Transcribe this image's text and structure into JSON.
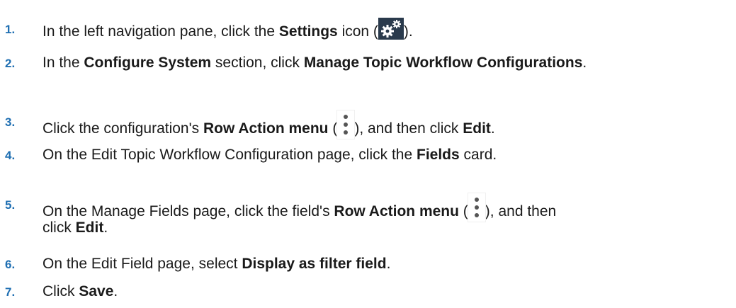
{
  "steps": [
    {
      "number": "1.",
      "text_a": "In the left navigation pane, click the ",
      "bold_a": "Settings",
      "text_b": " icon (",
      "icon": "gear-icon",
      "text_c": ")."
    },
    {
      "number": "2.",
      "text_a": "In the ",
      "bold_a": "Configure System",
      "text_b": " section, click ",
      "bold_b": "Manage Topic Workflow Configurations",
      "text_c": "."
    },
    {
      "number": "3.",
      "text_a": "Click the configuration's ",
      "bold_a": "Row Action menu",
      "text_b": " (",
      "icon": "kebab-menu-icon",
      "text_c": "), and then click ",
      "bold_b": "Edit",
      "text_d": "."
    },
    {
      "number": "4.",
      "text_a": "On the Edit Topic Workflow Configuration page, click the ",
      "bold_a": "Fields",
      "text_b": " card."
    },
    {
      "number": "5.",
      "text_a": "On the Manage Fields page, click the field's ",
      "bold_a": "Row Action menu",
      "text_b": " (",
      "icon": "kebab-menu-icon",
      "text_c": "), and then",
      "text_line2": "click ",
      "bold_b": "Edit",
      "text_d": "."
    },
    {
      "number": "6.",
      "text_a": "On the Edit Field page, select ",
      "bold_a": "Display as filter field",
      "text_b": "."
    },
    {
      "number": "7.",
      "text_a": "Click ",
      "bold_a": "Save",
      "text_b": "."
    }
  ],
  "colors": {
    "step_number": "#1f6fb2",
    "icon_background": "#2a3a4c",
    "text": "#1a1a1a"
  }
}
